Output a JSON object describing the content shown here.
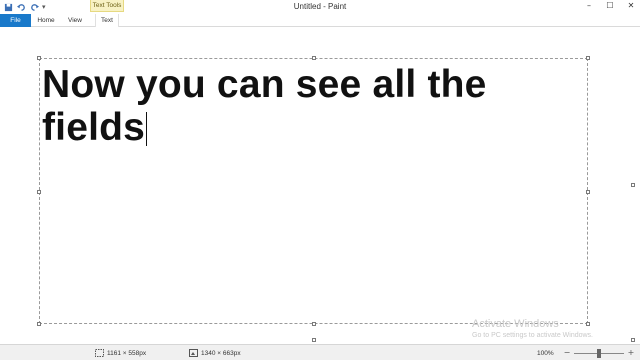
{
  "window": {
    "title": "Untitled - Paint",
    "context_tab": "Text Tools",
    "quick_access_icons": [
      "save-icon",
      "undo-icon",
      "redo-icon",
      "customize-chevron-icon"
    ],
    "controls": {
      "minimize": "–",
      "maximize": "☐",
      "close": "✕"
    }
  },
  "ribbon": {
    "tabs": [
      {
        "label": "File",
        "active": true,
        "color": "#1979ca"
      },
      {
        "label": "Home"
      },
      {
        "label": "View"
      },
      {
        "label": "Text"
      }
    ]
  },
  "canvas": {
    "text_lines": [
      "Now you can see all the",
      "fields"
    ]
  },
  "watermark": {
    "title": "Activate Windows",
    "subtitle": "Go to PC settings to activate Windows."
  },
  "statusbar": {
    "selection_size": "1161 × 558px",
    "image_size": "1340 × 663px",
    "zoom": "100%",
    "zoom_minus": "−",
    "zoom_plus": "+",
    "zoom_level_fraction": 0.5
  }
}
